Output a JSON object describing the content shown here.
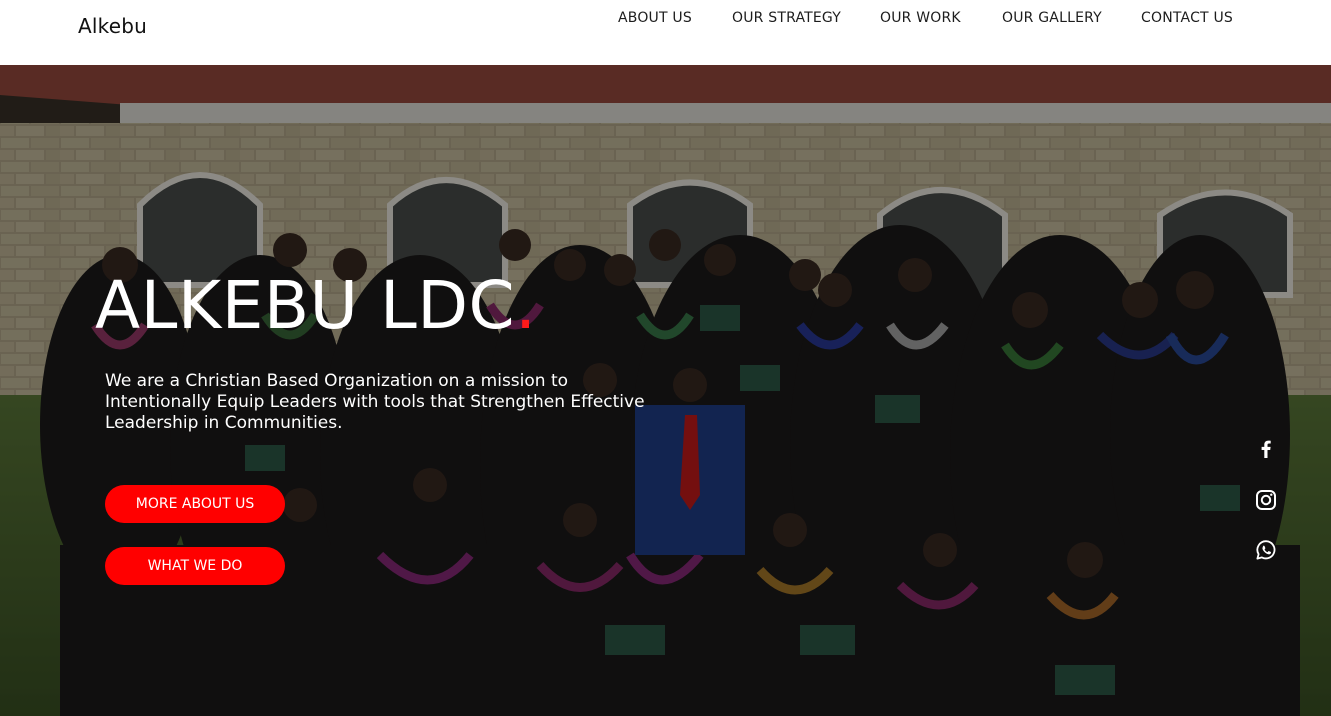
{
  "header": {
    "brand": "Alkebu",
    "nav": [
      {
        "label": "ABOUT US"
      },
      {
        "label": "OUR STRATEGY"
      },
      {
        "label": "OUR WORK"
      },
      {
        "label": "OUR GALLERY"
      },
      {
        "label": "CONTACT US"
      }
    ]
  },
  "hero": {
    "title": "ALKEBU LDC",
    "title_dot": ".",
    "description": "We are a Christian Based Organization on a mission to Intentionally Equip Leaders with tools that Strengthen Effective Leadership in Communities.",
    "buttons": {
      "more_about": "MORE ABOUT US",
      "what_we_do": "WHAT WE DO"
    },
    "background_image": "group-photo-graduates-in-front-of-brick-building"
  },
  "social": {
    "icons": [
      "facebook-icon",
      "instagram-icon",
      "whatsapp-icon"
    ]
  },
  "colors": {
    "accent": "#ff0000",
    "header_bg": "#ffffff",
    "text_light": "#ffffff"
  }
}
